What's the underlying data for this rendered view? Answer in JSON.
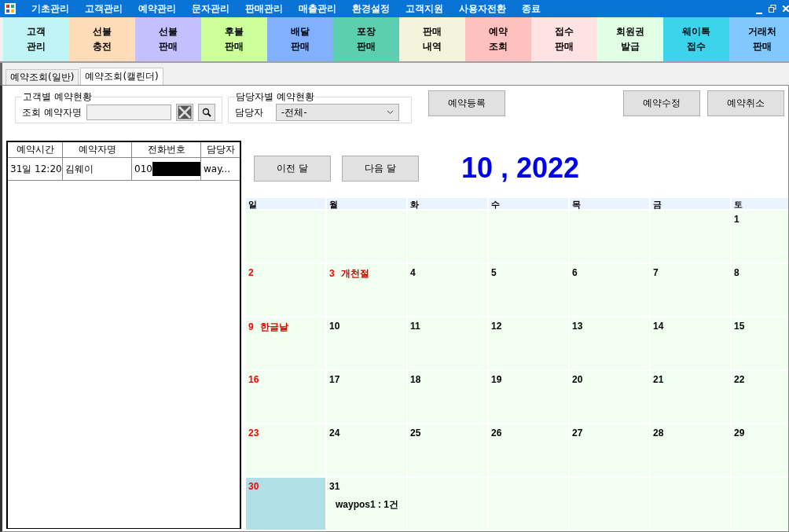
{
  "menu": [
    "기초관리",
    "고객관리",
    "예약관리",
    "문자관리",
    "판매관리",
    "매출관리",
    "환경설정",
    "고객지원",
    "사용자전환",
    "종료"
  ],
  "toolbar": [
    {
      "label": "고객\n관리",
      "color": "#c0f4f4"
    },
    {
      "label": "선불\n충전",
      "color": "#ffdcb8"
    },
    {
      "label": "선불\n판매",
      "color": "#c4c0ff"
    },
    {
      "label": "후불\n판매",
      "color": "#ccff99"
    },
    {
      "label": "배달\n판매",
      "color": "#80b0ff"
    },
    {
      "label": "포장\n판매",
      "color": "#5ccfb0"
    },
    {
      "label": "판매\n내역",
      "color": "#f4f4dc"
    },
    {
      "label": "예약\n조회",
      "color": "#ffc0c0"
    },
    {
      "label": "접수\n판매",
      "color": "#ffe2e2"
    },
    {
      "label": "회원권\n발급",
      "color": "#e0ffe4"
    },
    {
      "label": "웨이톡\n접수",
      "color": "#3cd4ec"
    },
    {
      "label": "거래처\n판매",
      "color": "#80c8ff"
    }
  ],
  "tabs": [
    {
      "label": "예약조회(일반)",
      "selected": false
    },
    {
      "label": "예약조회(캘린더)",
      "selected": true
    }
  ],
  "customer_group": {
    "title": "고객별 예약현황",
    "label": "조회 예약자명"
  },
  "staff_group": {
    "title": "담당자별 예약현황",
    "label": "담당자",
    "value": "-전체-"
  },
  "buttons": {
    "register": "예약등록",
    "edit": "예약수정",
    "cancel": "예약취소",
    "prev": "이전 달",
    "next": "다음 달"
  },
  "table": {
    "columns": [
      "예약시간",
      "예약자명",
      "전화번호",
      "담당자"
    ],
    "rows": [
      {
        "cells": [
          "31일 12:20",
          "김웨이",
          "010",
          "way..."
        ],
        "redacted": true
      }
    ]
  },
  "month_title": "10 , 2022",
  "weekdays": [
    "일",
    "월",
    "화",
    "수",
    "목",
    "금",
    "토"
  ],
  "weeks": [
    {
      "kind": "starts_late",
      "days": [
        {
          "day": "1",
          "holiday": false,
          "selected": false
        }
      ]
    },
    {
      "kind": "full",
      "days": [
        {
          "day": "2",
          "holiday": true,
          "selected": false
        },
        {
          "day": "3",
          "holiday": true,
          "selected": false,
          "label": "개천절"
        },
        {
          "day": "4",
          "holiday": false,
          "selected": false
        },
        {
          "day": "5",
          "holiday": false,
          "selected": false
        },
        {
          "day": "6",
          "holiday": false,
          "selected": false
        },
        {
          "day": "7",
          "holiday": false,
          "selected": false
        },
        {
          "day": "8",
          "holiday": false,
          "selected": false
        }
      ]
    },
    {
      "kind": "full",
      "days": [
        {
          "day": "9",
          "holiday": true,
          "selected": false,
          "label": "한글날"
        },
        {
          "day": "10",
          "holiday": false,
          "selected": false
        },
        {
          "day": "11",
          "holiday": false,
          "selected": false
        },
        {
          "day": "12",
          "holiday": false,
          "selected": false
        },
        {
          "day": "13",
          "holiday": false,
          "selected": false
        },
        {
          "day": "14",
          "holiday": false,
          "selected": false
        },
        {
          "day": "15",
          "holiday": false,
          "selected": false
        }
      ]
    },
    {
      "kind": "full",
      "days": [
        {
          "day": "16",
          "holiday": true,
          "selected": false
        },
        {
          "day": "17",
          "holiday": false,
          "selected": false
        },
        {
          "day": "18",
          "holiday": false,
          "selected": false
        },
        {
          "day": "19",
          "holiday": false,
          "selected": false
        },
        {
          "day": "20",
          "holiday": false,
          "selected": false
        },
        {
          "day": "21",
          "holiday": false,
          "selected": false
        },
        {
          "day": "22",
          "holiday": false,
          "selected": false
        }
      ]
    },
    {
      "kind": "full",
      "days": [
        {
          "day": "23",
          "holiday": true,
          "selected": false
        },
        {
          "day": "24",
          "holiday": false,
          "selected": false
        },
        {
          "day": "25",
          "holiday": false,
          "selected": false
        },
        {
          "day": "26",
          "holiday": false,
          "selected": false
        },
        {
          "day": "27",
          "holiday": false,
          "selected": false
        },
        {
          "day": "28",
          "holiday": false,
          "selected": false
        },
        {
          "day": "29",
          "holiday": false,
          "selected": false
        }
      ]
    },
    {
      "kind": "ends_early",
      "days": [
        {
          "day": "30",
          "holiday": true,
          "selected": true
        },
        {
          "day": "31",
          "holiday": false,
          "selected": false,
          "event": "waypos1 : 1건"
        }
      ]
    }
  ]
}
